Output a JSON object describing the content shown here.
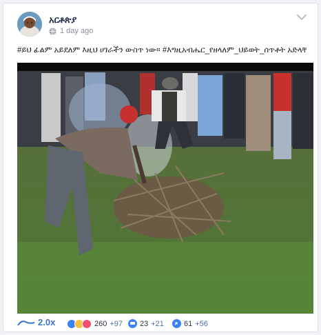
{
  "post": {
    "author": "አርቶጵያ",
    "time": "1 day ago",
    "caption": "#ይህ ፊልም አይደለም እዚህ ሀገራችን ውስጥ ነው። #እግዚአብሔር_የዘላለም_ህይወት_ሰጥቶት አድላቸው።"
  },
  "icons": {
    "globe": "globe-icon",
    "menu": "chevron-down-icon",
    "ratio": "trend-line-icon",
    "reactions": "reaction-icons",
    "comments": "comment-icon",
    "shares": "share-icon"
  },
  "stats": {
    "ratio": "2.0x",
    "reactions": "260",
    "reactions_delta": "+97",
    "comments": "23",
    "comments_delta": "+21",
    "shares": "61",
    "shares_delta": "+56"
  },
  "colors": {
    "accent": "#3a73c8",
    "reaction_like": "#3b82f6",
    "reaction_love": "#f0506e",
    "reaction_haha": "#f7c244"
  }
}
